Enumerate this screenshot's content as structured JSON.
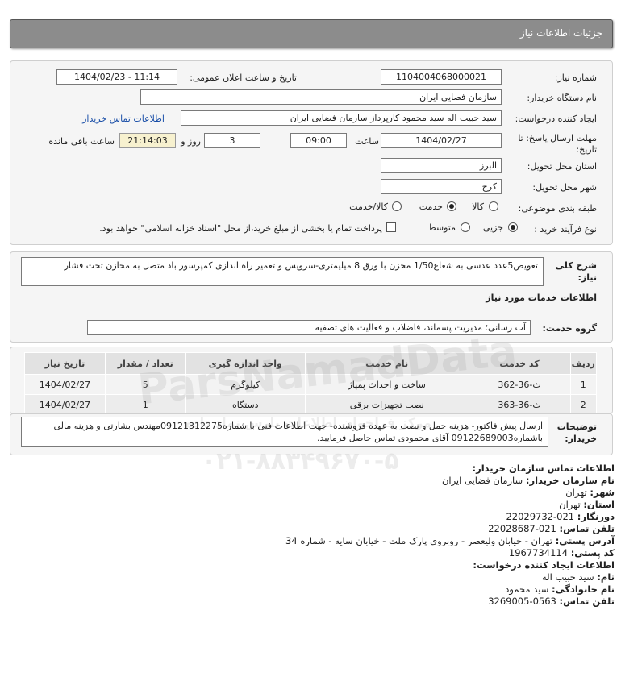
{
  "header": {
    "title": "جزئیات اطلاعات نیاز"
  },
  "form": {
    "need_number_label": "شماره نیاز:",
    "need_number": "1104004068000021",
    "announce_label": "تاریخ و ساعت اعلان عمومی:",
    "announce_value": "1404/02/23 - 11:14",
    "buyer_org_label": "نام دستگاه خریدار:",
    "buyer_org": "سازمان فضایی ایران",
    "creator_label": "ایجاد کننده درخواست:",
    "creator": "سید حبیب اله سید محمود کارپرداز سازمان فضایی ایران",
    "buyer_contact_link": "اطلاعات تماس خریدار",
    "deadline_label": "مهلت ارسال پاسخ: تا تاریخ:",
    "deadline_date": "1404/02/27",
    "time_label": "ساعت",
    "deadline_time": "09:00",
    "days_value": "3",
    "days_label": "روز و",
    "remaining_time": "21:14:03",
    "remaining_label": "ساعت باقی مانده",
    "province_label": "استان محل تحویل:",
    "province": "البرز",
    "city_label": "شهر محل تحویل:",
    "city": "کرج",
    "category_label": "طبقه بندی موضوعی:",
    "category_options": [
      "کالا",
      "خدمت",
      "کالا/خدمت"
    ],
    "category_selected": "خدمت",
    "process_label": "نوع فرآیند خرید :",
    "process_options": [
      "جزیی",
      "متوسط"
    ],
    "process_selected": "جزیی",
    "treasury_note": "پرداخت تمام یا بخشی از مبلغ خرید،از محل \"اسناد خزانه اسلامی\" خواهد بود."
  },
  "description": {
    "label": "شرح کلی نیاز:",
    "text": "تعویض5عدد عدسی به شعاع1/50 مخزن با ورق 8 میلیمتری-سرویس و تعمیر راه اندازی کمپرسور باد متصل به مخازن تحت فشار"
  },
  "services": {
    "section_title": "اطلاعات خدمات مورد نیاز",
    "group_label": "گروه خدمت:",
    "group_value": "آب رسانی؛ مدیریت پسماند، فاضلاب و فعالیت های تصفیه",
    "columns": [
      "ردیف",
      "کد خدمت",
      "نام خدمت",
      "واحد اندازه گیری",
      "تعداد / مقدار",
      "تاریخ نیاز"
    ],
    "rows": [
      {
        "row": "1",
        "code": "ث-36-362",
        "name": "ساخت و احداث پمپاژ",
        "unit": "کیلوگرم",
        "qty": "5",
        "date": "1404/02/27"
      },
      {
        "row": "2",
        "code": "ث-36-363",
        "name": "نصب تجهیزات برقی",
        "unit": "دستگاه",
        "qty": "1",
        "date": "1404/02/27"
      }
    ]
  },
  "buyer_notes": {
    "label": "توضیحات خریدار:",
    "text": "ارسال پیش فاکتور- هزینه حمل و نصب به عهده فروشنده- جهت اطلاعات فنی با شماره09121312275مهندس بشارتی و هزینه مالی باشماره09122689003 آقای محمودی تماس حاصل فرمایید."
  },
  "contact": {
    "title": "اطلاعات تماس سازمان خریدار:",
    "org_label": "نام سازمان خریدار:",
    "org": "سازمان فضایی ایران",
    "city_label": "شهر:",
    "city": "تهران",
    "province_label": "استان:",
    "province": "تهران",
    "fax_label": "دورنگار:",
    "fax": "021-22029732",
    "phone_label": "تلفن تماس:",
    "phone": "021-22028687",
    "address_label": "آدرس پستی:",
    "address": "تهران - خیابان ولیعصر - روبروی پارک ملت - خیابان سایه - شماره 34",
    "postal_label": "کد پستی:",
    "postal": "1967734114",
    "creator_title": "اطلاعات ایجاد کننده درخواست:",
    "first_name_label": "نام:",
    "first_name": "سید حبیب اله",
    "last_name_label": "نام خانوادگی:",
    "last_name": "سید محمود",
    "creator_phone_label": "تلفن تماس:",
    "creator_phone": "0563-3269005"
  },
  "watermark": {
    "brand": "ParsNamadData",
    "phone": "۰۲۱-۸۸۳۴۹۶۷۰-۵",
    "tagline": "مرکز فراخوان اطلاعات پارس نماد داده"
  }
}
